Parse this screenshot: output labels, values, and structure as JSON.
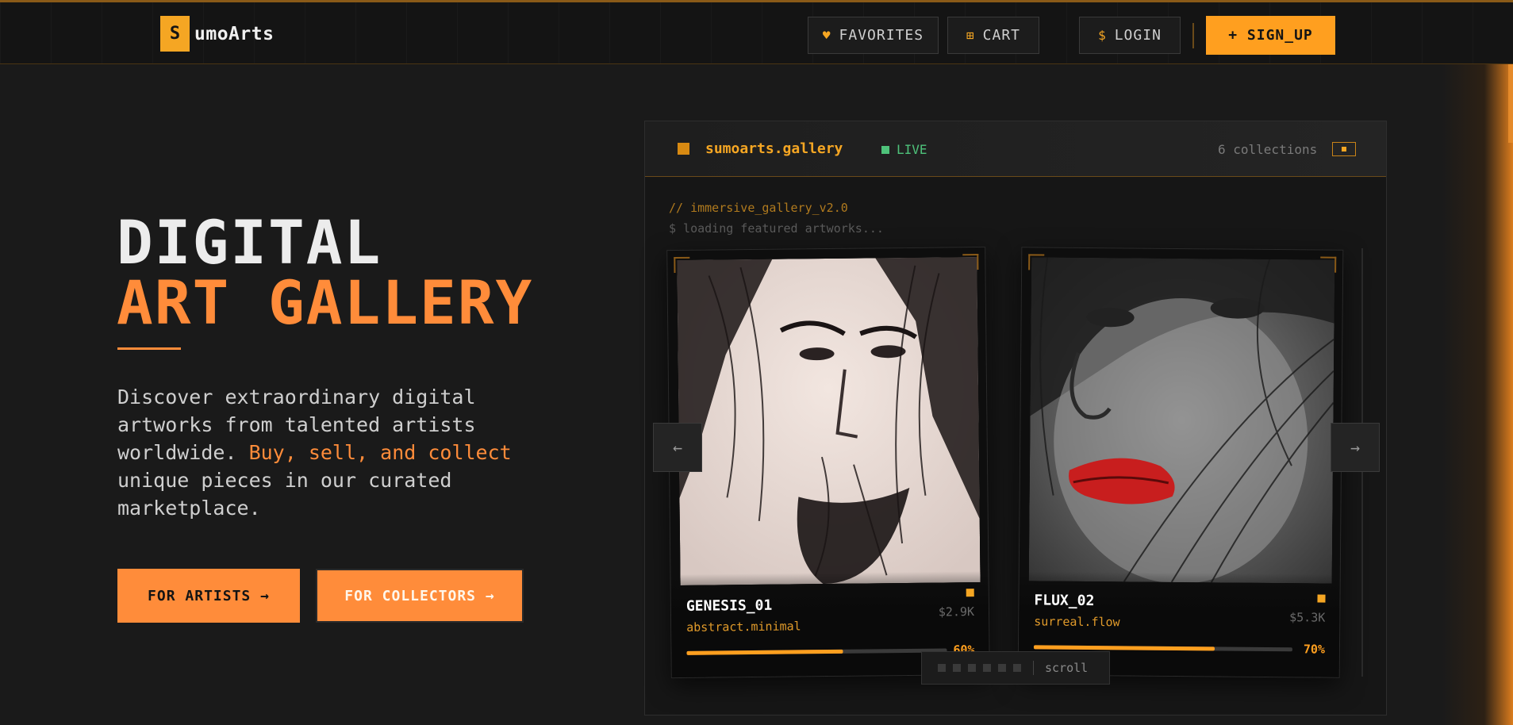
{
  "nav": {
    "logo_letter": "S",
    "logo_text": "umoArts",
    "favorites_icon": "♥",
    "favorites_label": "FAVORITES",
    "cart_icon": "⊞",
    "cart_label": "CART",
    "login_icon": "$",
    "login_label": "LOGIN",
    "signup_label": "+ SIGN_UP"
  },
  "hero": {
    "title_line1": "DIGITAL",
    "title_line2": "ART GALLERY",
    "desc_part1": "Discover extraordinary digital artworks from talented artists worldwide. ",
    "desc_highlight": "Buy, sell, and collect",
    "desc_part2": " unique pieces in our curated marketplace.",
    "cta_artists": "FOR ARTISTS →",
    "cta_collectors": "FOR COLLECTORS →"
  },
  "gallery": {
    "title": "sumoarts.gallery",
    "status": "LIVE",
    "collections": "6 collections",
    "comment": "// immersive_gallery_v2.0",
    "loading": "$ loading featured artworks...",
    "prev_icon": "←",
    "next_icon": "→",
    "pager_label": "scroll",
    "cards": [
      {
        "name": "GENESIS_01",
        "style": "abstract.minimal",
        "price": "$2.9K",
        "progress_pct": 60,
        "progress_label": "60%"
      },
      {
        "name": "FLUX_02",
        "style": "surreal.flow",
        "price": "$5.3K",
        "progress_pct": 70,
        "progress_label": "70%"
      }
    ]
  },
  "colors": {
    "accent": "#ff8c3a",
    "brand": "#f5a623",
    "live": "#4ec27a",
    "background": "#1a1a1a"
  }
}
